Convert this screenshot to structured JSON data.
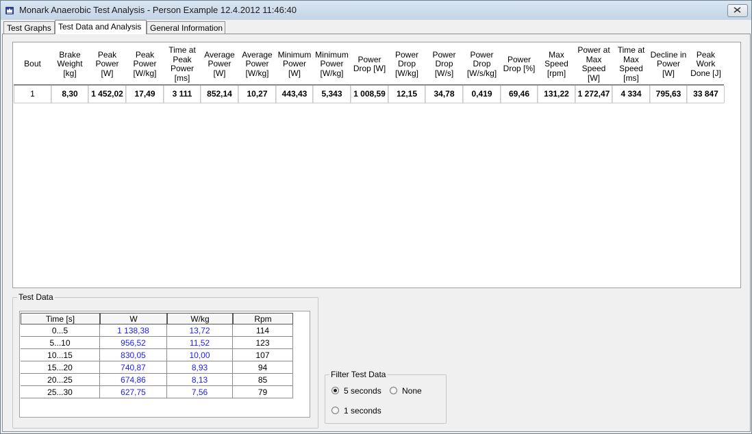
{
  "window": {
    "title": "Monark Anaerobic Test Analysis - Person Example 12.4.2012 11:46:40"
  },
  "tabs": [
    {
      "label": "Test Graphs",
      "active": false
    },
    {
      "label": "Test Data and Analysis",
      "active": true
    },
    {
      "label": "General Information",
      "active": false
    }
  ],
  "results_table": {
    "headers": [
      "Bout",
      "Brake Weight [kg]",
      "Peak Power [W]",
      "Peak Power [W/kg]",
      "Time at Peak Power [ms]",
      "Average Power [W]",
      "Average Power [W/kg]",
      "Minimum Power [W]",
      "Minimum Power [W/kg]",
      "Power Drop [W]",
      "Power Drop [W/kg]",
      "Power Drop [W/s]",
      "Power Drop [W/s/kg]",
      "Power Drop [%]",
      "Max Speed [rpm]",
      "Power at Max Speed [W]",
      "Time at Max Speed [ms]",
      "Decline in Power [W]",
      "Peak Work Done [J]"
    ],
    "rows": [
      [
        "1",
        "8,30",
        "1 452,02",
        "17,49",
        "3 111",
        "852,14",
        "10,27",
        "443,43",
        "5,343",
        "1 008,59",
        "12,15",
        "34,78",
        "0,419",
        "69,46",
        "131,22",
        "1 272,47",
        "4 334",
        "795,63",
        "33 847"
      ]
    ]
  },
  "test_data": {
    "group_label": "Test Data",
    "headers": [
      "Time [s]",
      "W",
      "W/kg",
      "Rpm"
    ],
    "rows": [
      [
        "0...5",
        "1 138,38",
        "13,72",
        "114"
      ],
      [
        "5...10",
        "956,52",
        "11,52",
        "123"
      ],
      [
        "10...15",
        "830,05",
        "10,00",
        "107"
      ],
      [
        "15...20",
        "740,87",
        "8,93",
        "94"
      ],
      [
        "20...25",
        "674,86",
        "8,13",
        "85"
      ],
      [
        "25...30",
        "627,75",
        "7,56",
        "79"
      ]
    ]
  },
  "filter": {
    "group_label": "Filter Test Data",
    "options": [
      {
        "label": "5 seconds",
        "selected": true
      },
      {
        "label": "None",
        "selected": false
      },
      {
        "label": "1 seconds",
        "selected": false
      }
    ]
  },
  "colors": {
    "accent_blue": "#1a1aff",
    "title_bar": "#c3d4e6"
  },
  "icons": {
    "app": "crown-icon",
    "close": "close-icon"
  }
}
